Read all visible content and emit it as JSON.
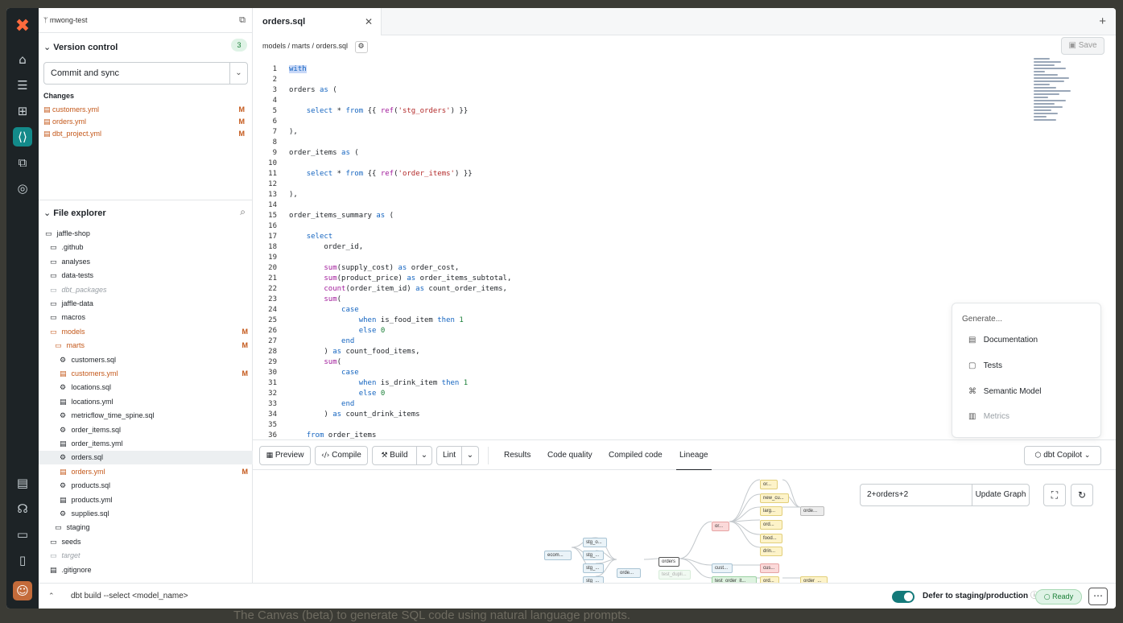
{
  "rail": {
    "logo": "✖",
    "items": [
      "home-icon",
      "database-icon",
      "layout-icon",
      "code-icon",
      "copy-icon",
      "compass-icon",
      "clipboard-icon",
      "headset-icon",
      "archive-icon",
      "phone-icon",
      "avatar-icon"
    ]
  },
  "sidebar": {
    "branch": "mwong-test",
    "version_control": {
      "title": "Version control",
      "count": "3",
      "commit_label": "Commit and sync",
      "changes_title": "Changes",
      "changes": [
        {
          "name": "customers.yml",
          "status": "M"
        },
        {
          "name": "orders.yml",
          "status": "M"
        },
        {
          "name": "dbt_project.yml",
          "status": "M"
        }
      ]
    },
    "file_explorer": {
      "title": "File explorer",
      "items": [
        {
          "name": "jaffle-shop",
          "icon": "▭",
          "indent": 0,
          "status": ""
        },
        {
          "name": ".github",
          "icon": "▭",
          "indent": 1,
          "status": ""
        },
        {
          "name": "analyses",
          "icon": "▭",
          "indent": 1,
          "status": ""
        },
        {
          "name": "data-tests",
          "icon": "▭",
          "indent": 1,
          "status": ""
        },
        {
          "name": "dbt_packages",
          "icon": "▭",
          "indent": 1,
          "status": "dim"
        },
        {
          "name": "jaffle-data",
          "icon": "▭",
          "indent": 1,
          "status": ""
        },
        {
          "name": "macros",
          "icon": "▭",
          "indent": 1,
          "status": ""
        },
        {
          "name": "models",
          "icon": "▭",
          "indent": 1,
          "status": "M"
        },
        {
          "name": "marts",
          "icon": "▭",
          "indent": 2,
          "status": "M"
        },
        {
          "name": "customers.sql",
          "icon": "⚙",
          "indent": 3,
          "status": ""
        },
        {
          "name": "customers.yml",
          "icon": "▤",
          "indent": 3,
          "status": "M"
        },
        {
          "name": "locations.sql",
          "icon": "⚙",
          "indent": 3,
          "status": ""
        },
        {
          "name": "locations.yml",
          "icon": "▤",
          "indent": 3,
          "status": ""
        },
        {
          "name": "metricflow_time_spine.sql",
          "icon": "⚙",
          "indent": 3,
          "status": ""
        },
        {
          "name": "order_items.sql",
          "icon": "⚙",
          "indent": 3,
          "status": ""
        },
        {
          "name": "order_items.yml",
          "icon": "▤",
          "indent": 3,
          "status": ""
        },
        {
          "name": "orders.sql",
          "icon": "⚙",
          "indent": 3,
          "status": "sel"
        },
        {
          "name": "orders.yml",
          "icon": "▤",
          "indent": 3,
          "status": "M"
        },
        {
          "name": "products.sql",
          "icon": "⚙",
          "indent": 3,
          "status": ""
        },
        {
          "name": "products.yml",
          "icon": "▤",
          "indent": 3,
          "status": ""
        },
        {
          "name": "supplies.sql",
          "icon": "⚙",
          "indent": 3,
          "status": ""
        },
        {
          "name": "staging",
          "icon": "▭",
          "indent": 2,
          "status": ""
        },
        {
          "name": "seeds",
          "icon": "▭",
          "indent": 1,
          "status": ""
        },
        {
          "name": "target",
          "icon": "▭",
          "indent": 1,
          "status": "dim"
        },
        {
          "name": ".gitignore",
          "icon": "▤",
          "indent": 1,
          "status": ""
        }
      ]
    }
  },
  "editor": {
    "tab_label": "orders.sql",
    "breadcrumb": "models / marts / orders.sql",
    "save_label": "Save",
    "lines": [
      "with",
      "",
      "orders as (",
      "",
      "    select * from {{ ref('stg_orders') }}",
      "",
      "),",
      "",
      "order_items as (",
      "",
      "    select * from {{ ref('order_items') }}",
      "",
      "),",
      "",
      "order_items_summary as (",
      "",
      "    select",
      "        order_id,",
      "",
      "        sum(supply_cost) as order_cost,",
      "        sum(product_price) as order_items_subtotal,",
      "        count(order_item_id) as count_order_items,",
      "        sum(",
      "            case",
      "                when is_food_item then 1",
      "                else 0",
      "            end",
      "        ) as count_food_items,",
      "        sum(",
      "            case",
      "                when is_drink_item then 1",
      "                else 0",
      "            end",
      "        ) as count_drink_items",
      "",
      "    from order_items"
    ]
  },
  "generate_menu": {
    "header": "Generate...",
    "items": [
      {
        "label": "Documentation",
        "icon": "▤"
      },
      {
        "label": "Tests",
        "icon": "▢"
      },
      {
        "label": "Semantic Model",
        "icon": "⌘"
      },
      {
        "label": "Metrics",
        "icon": "▥"
      }
    ]
  },
  "bottom_toolbar": {
    "preview": "Preview",
    "compile": "Compile",
    "build": "Build",
    "lint": "Lint",
    "tabs": [
      "Results",
      "Code quality",
      "Compiled code",
      "Lineage"
    ],
    "active_tab": "Lineage",
    "copilot": "dbt Copilot"
  },
  "lineage": {
    "graph_query": "2+orders+2",
    "update_label": "Update Graph",
    "nodes": [
      "or...",
      "new_cu...",
      "larg...",
      "ord...",
      "food...",
      "drin...",
      "orde...",
      "or...",
      "stg_o...",
      "stg_...",
      "stg_...",
      "stg_...",
      "ecom...",
      "orde...",
      "orders",
      "test_dupli...",
      "cust...",
      "test_order_it...",
      "cus...",
      "ord...",
      "order_..."
    ]
  },
  "status_bar": {
    "command_placeholder": "dbt build --select <model_name>",
    "defer_label": "Defer to staging/production",
    "ready_label": "Ready"
  },
  "overlay_text": "The Canvas (beta) to generate SQL code using natural language prompts."
}
